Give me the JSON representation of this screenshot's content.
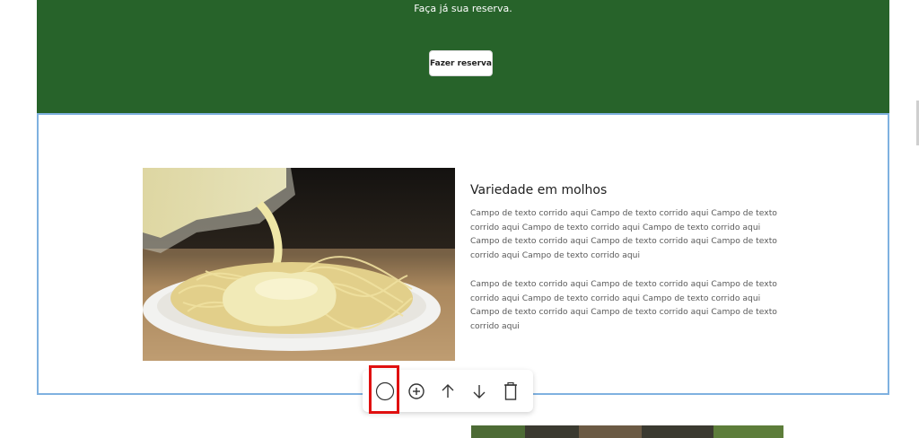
{
  "hero": {
    "subtitle": "Faça já sua reserva.",
    "button_label": "Fazer reserva",
    "background": "#27632a"
  },
  "section": {
    "title": "Variedade em molhos",
    "paragraph1": "Campo de texto corrido aqui Campo de texto corrido aqui  Campo de texto corrido aqui  Campo de texto corrido aqui  Campo de texto corrido aqui Campo de texto corrido aqui  Campo de texto corrido aqui  Campo de texto corrido aqui Campo de texto corrido aqui",
    "paragraph2": "Campo de texto corrido aqui Campo de texto corrido aqui Campo de texto corrido aqui Campo de texto corrido aqui Campo de texto corrido aqui Campo de texto corrido aqui Campo de texto corrido aqui Campo de texto corrido aqui",
    "image": "pasta-with-cheese-sauce",
    "selected_border_color": "#7fb1e0"
  },
  "toolbar": {
    "items": [
      {
        "icon": "circle-icon"
      },
      {
        "icon": "add-circle-icon"
      },
      {
        "icon": "arrow-up-icon"
      },
      {
        "icon": "arrow-down-icon"
      },
      {
        "icon": "trash-icon"
      }
    ],
    "highlight_color": "#e01010"
  },
  "next_section": {
    "image": "food-photo-partial"
  }
}
